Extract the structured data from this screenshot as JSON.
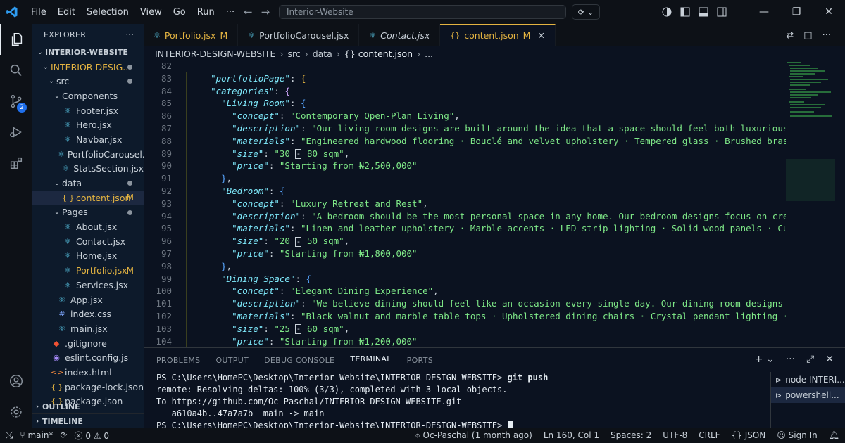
{
  "titlebar": {
    "menu": [
      "File",
      "Edit",
      "Selection",
      "View",
      "Go",
      "Run",
      "···"
    ],
    "search_text": "Interior-Website"
  },
  "sidebar": {
    "title": "EXPLORER",
    "more": "···",
    "root": "INTERIOR-WEBSITE",
    "items": [
      {
        "label": "INTERIOR-DESIG...",
        "indent": 1,
        "chev": "⌄",
        "gold": true,
        "dot": true
      },
      {
        "label": "src",
        "indent": 2,
        "chev": "⌄",
        "dot": true
      },
      {
        "label": "Components",
        "indent": 3,
        "chev": "⌄"
      },
      {
        "label": "Footer.jsx",
        "indent": 4,
        "icon": "react"
      },
      {
        "label": "Hero.jsx",
        "indent": 4,
        "icon": "react"
      },
      {
        "label": "Navbar.jsx",
        "indent": 4,
        "icon": "react"
      },
      {
        "label": "PortfolioCarousel.jsx",
        "indent": 4,
        "icon": "react"
      },
      {
        "label": "StatsSection.jsx",
        "indent": 4,
        "icon": "react"
      },
      {
        "label": "data",
        "indent": 3,
        "chev": "⌄",
        "dot": true
      },
      {
        "label": "content.json",
        "indent": 4,
        "icon": "json",
        "gold": true,
        "flag": "M",
        "sel": true
      },
      {
        "label": "Pages",
        "indent": 3,
        "chev": "⌄",
        "dot": true
      },
      {
        "label": "About.jsx",
        "indent": 4,
        "icon": "react"
      },
      {
        "label": "Contact.jsx",
        "indent": 4,
        "icon": "react"
      },
      {
        "label": "Home.jsx",
        "indent": 4,
        "icon": "react"
      },
      {
        "label": "Portfolio.jsx",
        "indent": 4,
        "icon": "react",
        "gold": true,
        "flag": "M"
      },
      {
        "label": "Services.jsx",
        "indent": 4,
        "icon": "react"
      },
      {
        "label": "App.jsx",
        "indent": 3,
        "icon": "react"
      },
      {
        "label": "index.css",
        "indent": 3,
        "icon": "css"
      },
      {
        "label": "main.jsx",
        "indent": 3,
        "icon": "react"
      },
      {
        "label": ".gitignore",
        "indent": 2,
        "icon": "git"
      },
      {
        "label": "eslint.config.js",
        "indent": 2,
        "icon": "eslint"
      },
      {
        "label": "index.html",
        "indent": 2,
        "icon": "html"
      },
      {
        "label": "package-lock.json",
        "indent": 2,
        "icon": "json"
      },
      {
        "label": "package.json",
        "indent": 2,
        "icon": "json"
      }
    ],
    "outline": "OUTLINE",
    "timeline": "TIMELINE"
  },
  "activity": {
    "scm_badge": "2"
  },
  "tabs": [
    {
      "label": "Portfolio.jsx",
      "icon": "react",
      "mod": "M",
      "italic": false
    },
    {
      "label": "PortfolioCarousel.jsx",
      "icon": "react",
      "mod": "",
      "italic": false
    },
    {
      "label": "Contact.jsx",
      "icon": "react",
      "mod": "",
      "italic": true
    },
    {
      "label": "content.json",
      "icon": "json",
      "mod": "M",
      "active": true
    }
  ],
  "breadcrumb": [
    "INTERIOR-DESIGN-WEBSITE",
    "src",
    "data",
    "{} content.json",
    "..."
  ],
  "editor": {
    "lines": [
      {
        "n": "82",
        "indent": 0,
        "parts": []
      },
      {
        "n": "83",
        "indent": 1,
        "parts": [
          [
            "k",
            "\"portfolioPage\""
          ],
          [
            "p",
            ": "
          ],
          [
            "b1",
            "{"
          ]
        ]
      },
      {
        "n": "84",
        "indent": 1,
        "parts": [
          [
            "k",
            "\"categories\""
          ],
          [
            "p",
            ": "
          ],
          [
            "b2",
            "{"
          ]
        ]
      },
      {
        "n": "85",
        "indent": 2,
        "parts": [
          [
            "k",
            "\"Living Room\""
          ],
          [
            "p",
            ": "
          ],
          [
            "b3",
            "{"
          ]
        ]
      },
      {
        "n": "86",
        "indent": 3,
        "parts": [
          [
            "k",
            "\"concept\""
          ],
          [
            "p",
            ": "
          ],
          [
            "s",
            "\"Contemporary Open-Plan Living\""
          ],
          [
            "p",
            ","
          ]
        ]
      },
      {
        "n": "87",
        "indent": 3,
        "parts": [
          [
            "k",
            "\"description\""
          ],
          [
            "p",
            ": "
          ],
          [
            "s",
            "\"Our living room designs are built around the idea that a space should feel both luxurious and l"
          ]
        ]
      },
      {
        "n": "88",
        "indent": 3,
        "parts": [
          [
            "k",
            "\"materials\""
          ],
          [
            "p",
            ": "
          ],
          [
            "s",
            "\"Engineered hardwood flooring · Bouclé and velvet upholstery · Tempered glass · Brushed brass fixt"
          ]
        ]
      },
      {
        "n": "89",
        "indent": 3,
        "parts": [
          [
            "k",
            "\"size\""
          ],
          [
            "p",
            ": "
          ],
          [
            "s",
            "\"30 "
          ],
          [
            "box",
            "-"
          ],
          [
            "s",
            " 80 sqm\""
          ],
          [
            "p",
            ","
          ]
        ]
      },
      {
        "n": "90",
        "indent": 3,
        "parts": [
          [
            "k",
            "\"price\""
          ],
          [
            "p",
            ": "
          ],
          [
            "s",
            "\"Starting from ₦2,500,000\""
          ]
        ]
      },
      {
        "n": "91",
        "indent": 2,
        "parts": [
          [
            "b3",
            "}"
          ],
          [
            "p",
            ","
          ]
        ]
      },
      {
        "n": "92",
        "indent": 2,
        "parts": [
          [
            "k",
            "\"Bedroom\""
          ],
          [
            "p",
            ": "
          ],
          [
            "b3",
            "{"
          ]
        ]
      },
      {
        "n": "93",
        "indent": 3,
        "parts": [
          [
            "k",
            "\"concept\""
          ],
          [
            "p",
            ": "
          ],
          [
            "s",
            "\"Luxury Retreat and Rest\""
          ],
          [
            "p",
            ","
          ]
        ]
      },
      {
        "n": "94",
        "indent": 3,
        "parts": [
          [
            "k",
            "\"description\""
          ],
          [
            "p",
            ": "
          ],
          [
            "s",
            "\"A bedroom should be the most personal space in any home. Our bedroom designs focus on creating a sanctuar"
          ]
        ]
      },
      {
        "n": "95",
        "indent": 3,
        "parts": [
          [
            "k",
            "\"materials\""
          ],
          [
            "p",
            ": "
          ],
          [
            "s",
            "\"Linen and leather upholstery · Marble accents · LED strip lighting · Solid wood panels · Custom built-in wa"
          ]
        ]
      },
      {
        "n": "96",
        "indent": 3,
        "parts": [
          [
            "k",
            "\"size\""
          ],
          [
            "p",
            ": "
          ],
          [
            "s",
            "\"20 "
          ],
          [
            "box",
            "-"
          ],
          [
            "s",
            " 50 sqm\""
          ],
          [
            "p",
            ","
          ]
        ]
      },
      {
        "n": "97",
        "indent": 3,
        "parts": [
          [
            "k",
            "\"price\""
          ],
          [
            "p",
            ": "
          ],
          [
            "s",
            "\"Starting from ₦1,800,000\""
          ]
        ]
      },
      {
        "n": "98",
        "indent": 2,
        "parts": [
          [
            "b3",
            "}"
          ],
          [
            "p",
            ","
          ]
        ]
      },
      {
        "n": "99",
        "indent": 2,
        "parts": [
          [
            "k",
            "\"Dining Space\""
          ],
          [
            "p",
            ": "
          ],
          [
            "b3",
            "{"
          ]
        ]
      },
      {
        "n": "100",
        "indent": 3,
        "parts": [
          [
            "k",
            "\"concept\""
          ],
          [
            "p",
            ": "
          ],
          [
            "s",
            "\"Elegant Dining Experience\""
          ],
          [
            "p",
            ","
          ]
        ]
      },
      {
        "n": "101",
        "indent": 3,
        "parts": [
          [
            "k",
            "\"description\""
          ],
          [
            "p",
            ": "
          ],
          [
            "s",
            "\"We believe dining should feel like an occasion every single day. Our dining room designs are centred aroun"
          ]
        ]
      },
      {
        "n": "102",
        "indent": 3,
        "parts": [
          [
            "k",
            "\"materials\""
          ],
          [
            "p",
            ": "
          ],
          [
            "s",
            "\"Black walnut and marble table tops · Upholstered dining chairs · Crystal pendant lighting · Fluted wall pane"
          ]
        ]
      },
      {
        "n": "103",
        "indent": 3,
        "parts": [
          [
            "k",
            "\"size\""
          ],
          [
            "p",
            ": "
          ],
          [
            "s",
            "\"25 "
          ],
          [
            "box",
            "-"
          ],
          [
            "s",
            " 60 sqm\""
          ],
          [
            "p",
            ","
          ]
        ]
      },
      {
        "n": "104",
        "indent": 3,
        "parts": [
          [
            "k",
            "\"price\""
          ],
          [
            "p",
            ": "
          ],
          [
            "s",
            "\"Starting from ₦1,200,000\""
          ]
        ]
      }
    ]
  },
  "panel": {
    "tabs": [
      "PROBLEMS",
      "OUTPUT",
      "DEBUG CONSOLE",
      "TERMINAL",
      "PORTS"
    ],
    "active_tab": "TERMINAL",
    "terminal": [
      {
        "prompt": "PS C:\\Users\\HomePC\\Desktop\\Interior-Website\\INTERIOR-DESIGN-WEBSITE> ",
        "cmd": "git push"
      },
      {
        "text": "remote: Resolving deltas: 100% (3/3), completed with 3 local objects."
      },
      {
        "text": "To https://github.com/Oc-Paschal/INTERIOR-DESIGN-WEBSITE.git"
      },
      {
        "text": "   a610a4b..47a7a7b  main -> main"
      },
      {
        "prompt": "PS C:\\Users\\HomePC\\Desktop\\Interior-Website\\INTERIOR-DESIGN-WEBSITE> ",
        "cmd": "",
        "cursor": true
      }
    ],
    "terminals": [
      "node INTERI...",
      "powershell..."
    ]
  },
  "statusbar": {
    "branch": "main*",
    "errors": "0",
    "warnings": "0",
    "author": "Oc-Paschal (1 month ago)",
    "position": "Ln 160, Col 1",
    "spaces": "Spaces: 2",
    "encoding": "UTF-8",
    "eol": "CRLF",
    "language": "JSON",
    "signin": "Sign In"
  },
  "colors": {
    "accent": "#e3b341",
    "key": "#7ee8fa",
    "string": "#7ee787",
    "badge": "#1f6feb"
  }
}
